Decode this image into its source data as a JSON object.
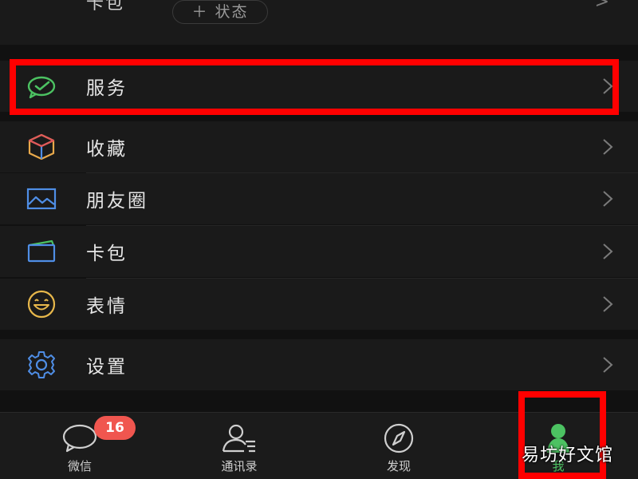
{
  "top_row": {
    "label": "卡包",
    "status_button": "＋ 状态"
  },
  "menu": {
    "service": "服务",
    "favorites": "收藏",
    "moments": "朋友圈",
    "cards": "卡包",
    "stickers": "表情",
    "settings": "设置"
  },
  "tabbar": {
    "chats": {
      "label": "微信",
      "badge": "16"
    },
    "contacts": {
      "label": "通讯录"
    },
    "discover": {
      "label": "发现"
    },
    "me": {
      "label": "我"
    }
  },
  "watermark": "易坊好文馆",
  "colors": {
    "background": "#111111",
    "row_background": "#1a1a1a",
    "accent_green": "#4cc262",
    "highlight_red": "#ff0000",
    "badge_red": "#f0564f"
  },
  "icons": {
    "service": "wechat-pay-icon",
    "favorites": "cube-icon",
    "moments": "photo-icon",
    "cards": "card-wallet-icon",
    "stickers": "smiley-icon",
    "settings": "gear-icon",
    "chats": "chat-bubble-icon",
    "contacts": "contacts-icon",
    "discover": "compass-icon",
    "me": "person-icon"
  }
}
